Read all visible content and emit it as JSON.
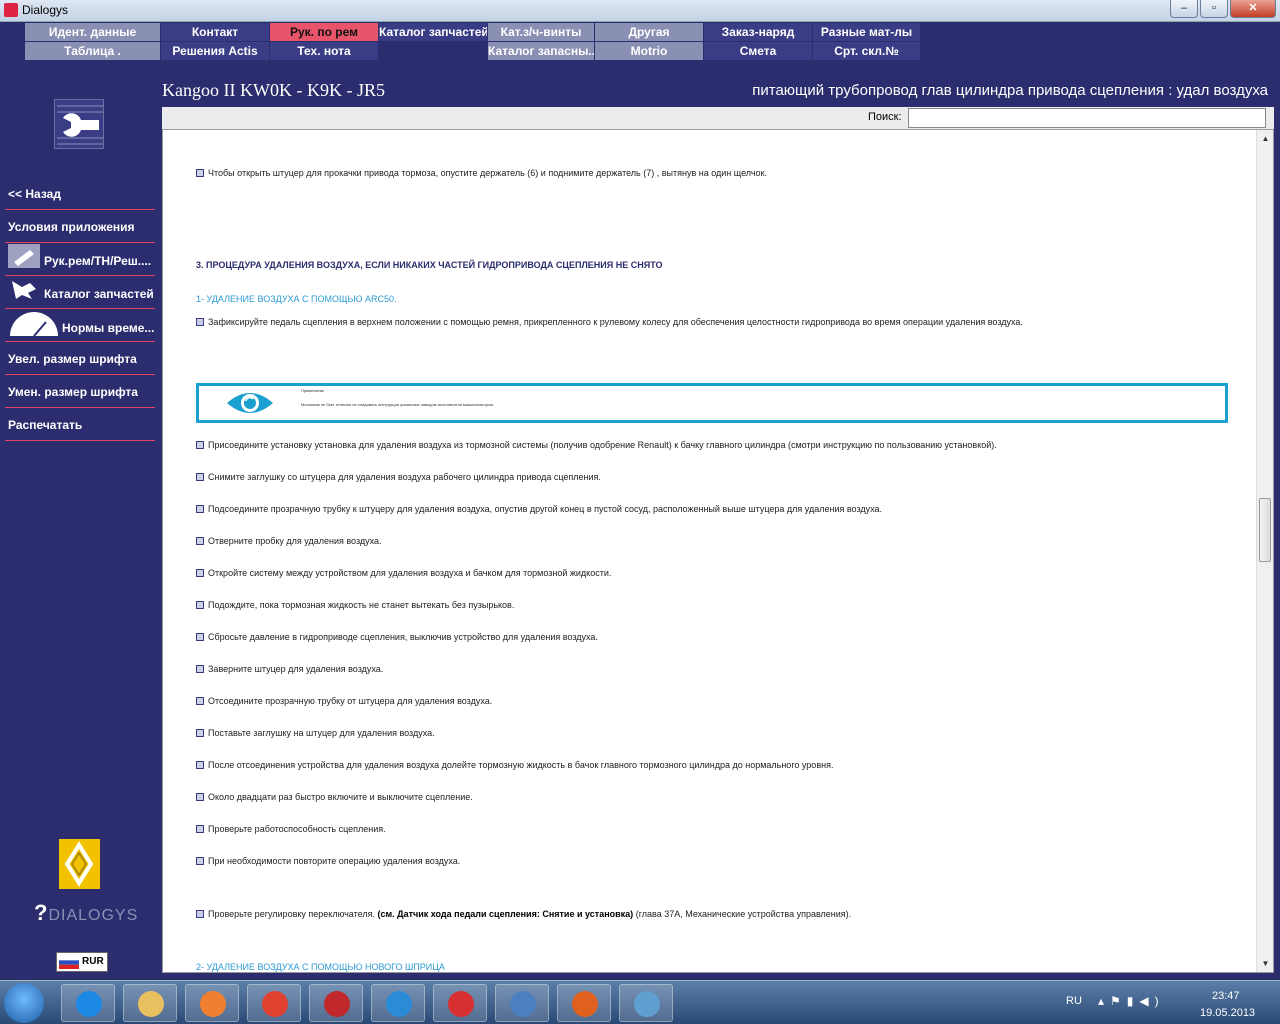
{
  "window": {
    "title": "Dialogys",
    "minimize": "–",
    "maximize": "▫",
    "close": "✕"
  },
  "tabs_row1": [
    {
      "label": "Идент. данные",
      "style": "gray"
    },
    {
      "label": "Контакт",
      "style": "navy"
    },
    {
      "label": "Рук. по рем",
      "style": "red"
    },
    {
      "label": "Каталог запчастей",
      "style": "navy"
    },
    {
      "label": "Кат.з/ч-винты",
      "style": "gray"
    },
    {
      "label": "Другая",
      "style": "gray"
    },
    {
      "label": "Заказ-наряд",
      "style": "navy"
    },
    {
      "label": "Разные мат-лы",
      "style": "navy"
    }
  ],
  "tabs_row2": [
    {
      "label": "Таблица .",
      "style": "gray"
    },
    {
      "label": "Решения Actis",
      "style": "navy"
    },
    {
      "label": "Тех. нота",
      "style": "navy"
    },
    {
      "label": "",
      "style": "empty"
    },
    {
      "label": "Каталог запасны...",
      "style": "gray"
    },
    {
      "label": "Motrio",
      "style": "gray"
    },
    {
      "label": "Смета",
      "style": "navy"
    },
    {
      "label": "Срт. скл.№",
      "style": "navy"
    }
  ],
  "header": {
    "vehicle": "Kangoo II KW0K - K9K - JR5",
    "procedure": "питающий трубопровод глав цилиндра привода сцепления : удал воздуха"
  },
  "search": {
    "label": "Поиск:",
    "value": ""
  },
  "sidebar": {
    "back": "<< Назад",
    "conditions": "Условия приложения",
    "repair_manual": "Рук.рем/ТН/Реш....",
    "parts_catalog": "Каталог запчастей",
    "labour_times": "Нормы време...",
    "font_bigger": "Увел. размер шрифта",
    "font_smaller": "Умен. размер шрифта",
    "print": "Распечатать",
    "brand_text": "DIALOGYS",
    "currency": "RUR"
  },
  "document": {
    "p_open_fitting": "Чтобы открыть штуцер для прокачки привода тормоза, опустите держатель (6) и поднимите держатель (7) , вытянув на один щелчок.",
    "section3": "3. ПРОЦЕДУРА УДАЛЕНИЯ ВОЗДУХА, ЕСЛИ НИКАКИХ ЧАСТЕЙ ГИДРОПРИВОДА СЦЕПЛЕНИЯ НЕ СНЯТО",
    "sub1": "1- УДАЛЕНИЕ ВОЗДУХА С ПОМОЩЬЮ ARC50.",
    "p_fix_pedal": "Зафиксируйте педаль сцепления в верхнем положении с помощью ремня, прикрепленного к рулевому колесу для обеспечения целостности гидропривода во время операции удаления воздуха.",
    "note_title": "Примечание",
    "note_text": "Механизм не бьет отнесем не следовать инструкции указанные заводом изготовителя машинизатором.",
    "steps": [
      "Присоедините установку установка для удаления воздуха из тормозной системы (получив одобрение Renault) к бачку главного цилиндра (смотри инструкцию по пользованию установкой).",
      "Снимите заглушку со штуцера для удаления воздуха рабочего цилиндра привода сцепления.",
      "Подсоедините прозрачную трубку к штуцеру для удаления воздуха, опустив другой конец в пустой сосуд, расположенный выше штуцера для удаления воздуха.",
      "Отверните пробку для удаления воздуха.",
      "Откройте систему между устройством для удаления воздуха и бачком для тормозной жидкости.",
      "Подождите, пока тормозная жидкость не станет вытекать без пузырьков.",
      "Сбросьте давление в гидроприводе сцепления, выключив устройство для удаления воздуха.",
      "Заверните штуцер для удаления воздуха.",
      "Отсоедините прозрачную трубку от штуцера для удаления воздуха.",
      "Поставьте заглушку на штуцер для удаления воздуха.",
      "После отсоединения устройства для удаления воздуха долейте тормозную жидкость в бачок главного тормозного цилиндра до нормального уровня.",
      "Около двадцати раз быстро включите и выключите сцепление.",
      "Проверьте работоспособность сцепления.",
      "При необходимости повторите операцию удаления воздуха."
    ],
    "last_pre": "Проверьте регулировку переключателя.",
    "last_ref": "(см. Датчик хода педали сцепления: Снятие и установка)",
    "last_post": "(глава 37A, Механические устройства управления).",
    "sub2": "2- УДАЛЕНИЕ ВОЗДУХА С ПОМОЩЬЮ НОВОГО ШПРИЦА"
  },
  "taskbar": {
    "apps": [
      "ie-icon",
      "explorer-icon",
      "media-player-icon",
      "chrome-icon",
      "kaspersky-icon",
      "z-icon",
      "yandex-icon",
      "volume-app-icon",
      "java-icon",
      "paint-icon"
    ],
    "lang": "RU",
    "time": "23:47",
    "date": "19.05.2013"
  },
  "colors": {
    "accent": "#2b2d6e",
    "tab_active": "#e8556b",
    "link": "#2b9ad3",
    "note_border": "#1aa0d0"
  }
}
